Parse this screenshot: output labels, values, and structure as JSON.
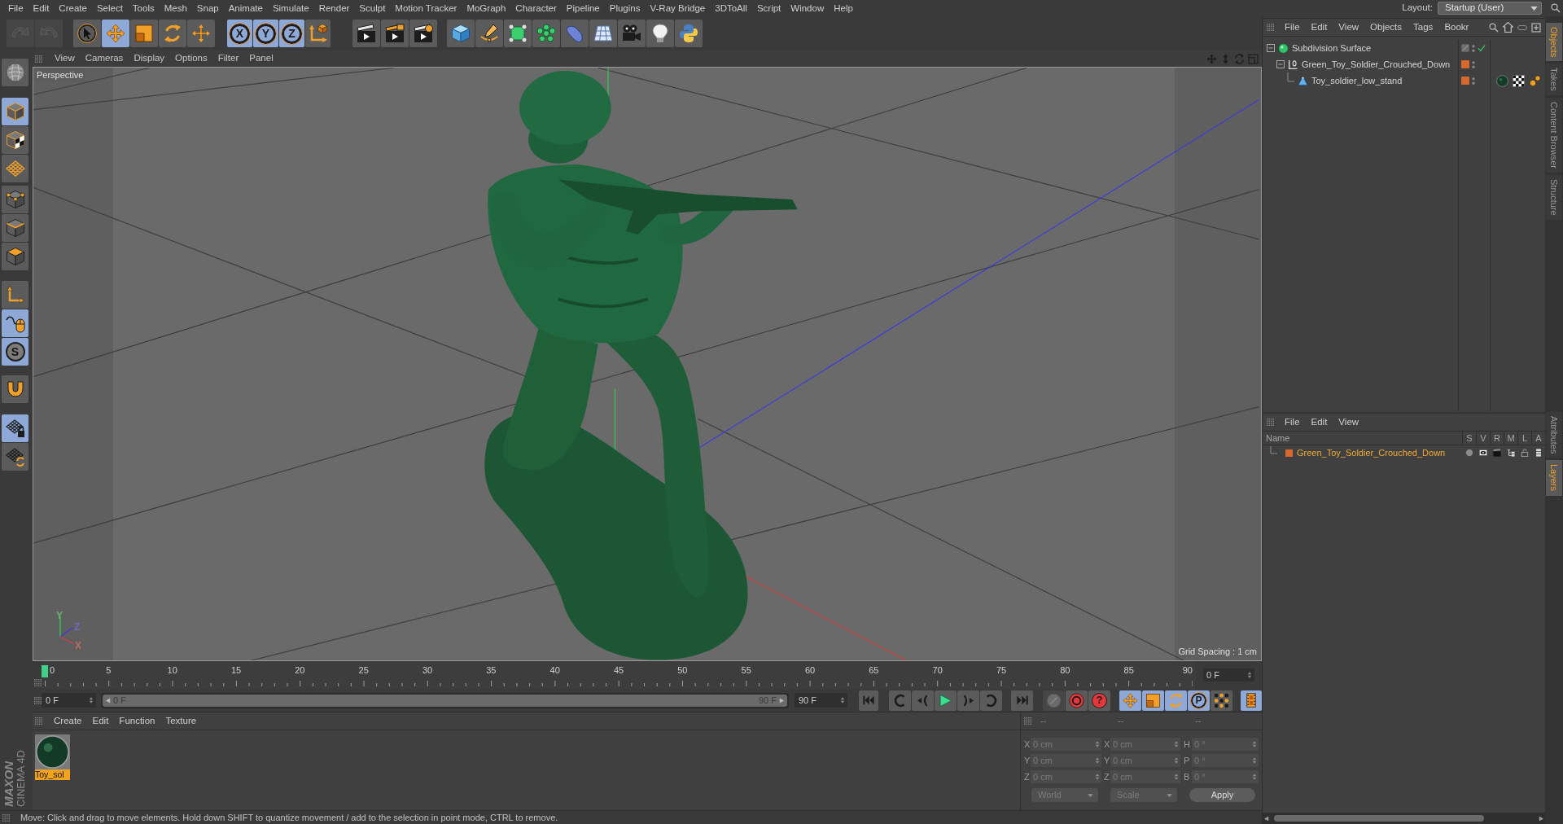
{
  "menu_bar": {
    "items": [
      "File",
      "Edit",
      "Create",
      "Select",
      "Tools",
      "Mesh",
      "Snap",
      "Animate",
      "Simulate",
      "Render",
      "Sculpt",
      "Motion Tracker",
      "MoGraph",
      "Character",
      "Pipeline",
      "Plugins",
      "V-Ray Bridge",
      "3DToAll",
      "Script",
      "Window",
      "Help"
    ],
    "layout_label": "Layout:",
    "layout_value": "Startup (User)"
  },
  "toolbar": {
    "history": [
      {
        "disabled": true
      },
      {
        "disabled": true
      }
    ],
    "tools": [
      {
        "selected": false
      },
      {
        "selected": true
      },
      {
        "selected": false
      },
      {
        "selected": false
      },
      {
        "selected": false
      }
    ],
    "axes": [
      {
        "label": "X",
        "selected": true
      },
      {
        "label": "Y",
        "selected": true
      },
      {
        "label": "Z",
        "selected": true
      }
    ]
  },
  "left_toolbar": {
    "groups": [
      {
        "tools": [
          {
            "selected": true
          },
          {
            "selected": false
          },
          {
            "selected": false
          }
        ]
      },
      {
        "tools": [
          {
            "selected": false
          },
          {
            "selected": false
          },
          {
            "selected": false
          }
        ]
      },
      {
        "tools": [
          {
            "selected": false
          },
          {
            "selected": true
          },
          {
            "selected": true,
            "label": "S"
          }
        ]
      },
      {
        "tools": [
          {
            "selected": false
          }
        ]
      },
      {
        "tools": [
          {
            "selected": true
          },
          {
            "selected": false
          }
        ]
      }
    ],
    "logo": {
      "brand": "MAXON",
      "product": "CINEMA 4D"
    }
  },
  "viewport": {
    "menu": [
      "View",
      "Cameras",
      "Display",
      "Options",
      "Filter",
      "Panel"
    ],
    "camera": "Perspective",
    "grid_spacing": "Grid Spacing : 1 cm",
    "axis_labels": [
      {
        "label": "Y",
        "color": "#70b070"
      },
      {
        "label": "Z",
        "color": "#6a6ac0"
      },
      {
        "label": "X",
        "color": "#c06a6a"
      }
    ]
  },
  "timeline": {
    "frame_labels": [
      "0",
      "5",
      "10",
      "15",
      "20",
      "25",
      "30",
      "35",
      "40",
      "45",
      "50",
      "55",
      "60",
      "65",
      "70",
      "75",
      "80",
      "85",
      "90"
    ],
    "playhead": {
      "level": 0
    },
    "current_frame": "0 F",
    "start_field": "0 F",
    "range": {
      "start": "0 F",
      "end": "90 F",
      "level": 1
    },
    "end_field": "90 F"
  },
  "animation_toolbar": {
    "record": [
      {
        "kind": "record",
        "disabled": true
      },
      {
        "kind": "autokey",
        "disabled": false
      },
      {
        "kind": "keyhelp",
        "label": "?",
        "disabled": false
      }
    ],
    "key_tools": [
      {
        "kind": "move",
        "selected": true
      },
      {
        "kind": "scale",
        "selected": true
      },
      {
        "kind": "rotate",
        "selected": true
      },
      {
        "kind": "param",
        "label": "P",
        "selected": true
      },
      {
        "kind": "points",
        "selected": false
      }
    ],
    "timeline_toggle": {
      "selected": true
    }
  },
  "material_manager": {
    "menu": [
      "Create",
      "Edit",
      "Function",
      "Texture"
    ],
    "materials": [
      {
        "name": "Toy_sol",
        "selected": true
      }
    ]
  },
  "coordinates": {
    "headers": [
      "--",
      "--",
      "--"
    ],
    "rows": [
      {
        "position_axis": "X",
        "position": "0 cm",
        "size_axis": "X",
        "size": "0 cm",
        "rotation_axis": "H",
        "rotation": "0 °"
      },
      {
        "position_axis": "Y",
        "position": "0 cm",
        "size_axis": "Y",
        "size": "0 cm",
        "rotation_axis": "P",
        "rotation": "0 °"
      },
      {
        "position_axis": "Z",
        "position": "0 cm",
        "size_axis": "Z",
        "size": "0 cm",
        "rotation_axis": "B",
        "rotation": "0 °"
      }
    ],
    "mode": {
      "value": "World",
      "disabled": true
    },
    "size_mode": {
      "value": "Scale",
      "disabled": true
    },
    "apply": "Apply"
  },
  "object_manager": {
    "menu": [
      "File",
      "Edit",
      "View",
      "Objects",
      "Tags",
      "Bookr"
    ],
    "objects": [
      {
        "name": "Subdivision Surface",
        "kind": "generator",
        "expanded": true,
        "enabled": true,
        "children": [
          {
            "name": "Green_Toy_Soldier_Crouched_Down",
            "kind": "null",
            "expanded": true,
            "color": "#d8692e",
            "children": [
              {
                "name": "Toy_soldier_low_stand",
                "kind": "polygon",
                "color": "#d8692e",
                "tags": [
                  {
                    "kind": "material"
                  },
                  {
                    "kind": "uvw"
                  },
                  {
                    "kind": "phong"
                  }
                ]
              }
            ]
          }
        ]
      }
    ]
  },
  "layer_manager": {
    "menu": [
      "File",
      "Edit",
      "View"
    ],
    "columns": [
      "Name",
      "S",
      "V",
      "R",
      "M",
      "L",
      "A"
    ],
    "layers": [
      {
        "name": "Green_Toy_Soldier_Crouched_Down",
        "color": "#d8692e",
        "selected": true
      }
    ]
  },
  "side_tabs": {
    "top": [
      {
        "label": "Objects",
        "selected": true
      },
      {
        "label": "Takes",
        "selected": false
      },
      {
        "label": "Content Browser",
        "selected": false
      },
      {
        "label": "Structure",
        "selected": false
      }
    ],
    "bottom": [
      {
        "label": "Attributes",
        "selected": false
      },
      {
        "label": "Layers",
        "selected": true
      }
    ]
  },
  "status_bar": "Move: Click and drag to move elements. Hold down SHIFT to quantize movement / add to the selection in point mode, CTRL to remove."
}
